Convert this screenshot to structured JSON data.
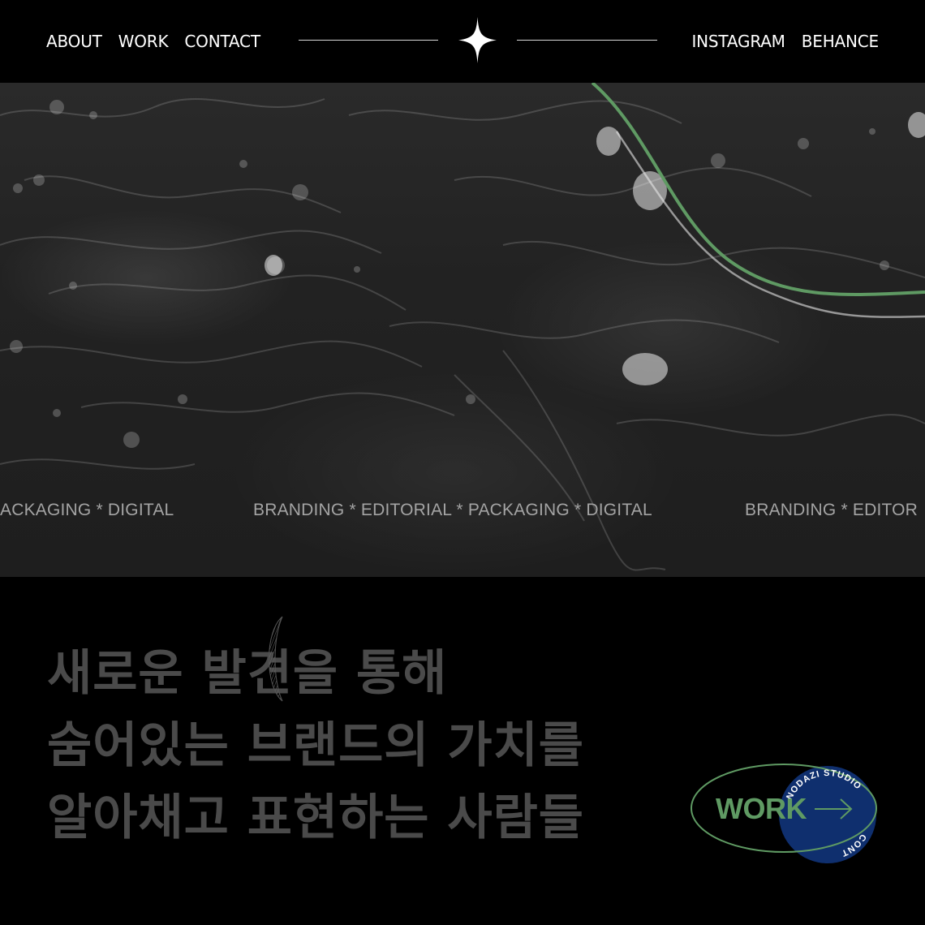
{
  "nav": {
    "left": [
      "ABOUT",
      "WORK",
      "CONTACT"
    ],
    "right": [
      "INSTAGRAM",
      "BEHANCE"
    ]
  },
  "hero": {
    "marquee": {
      "items": [
        "ACKAGING * DIGITAL",
        "BRANDING * EDITORIAL * PACKAGING * DIGITAL",
        "BRANDING * EDITOR"
      ]
    }
  },
  "tagline": {
    "lines": [
      "새로운 발견을 통해",
      "숨어있는 브랜드의 가치를",
      "알아채고 표현하는 사람들"
    ]
  },
  "work_badge": {
    "label": "WORK",
    "circle_text": "NODAZI STUDIO",
    "circle_text_2": "CONT"
  },
  "colors": {
    "accent_green": "#5f9a63",
    "badge_blue": "#0f2f6e",
    "background": "#000000",
    "tagline_gray": "#4a4a4a"
  },
  "icons": {
    "logo": "four-point-star-icon",
    "arrow": "arrow-right-icon"
  }
}
